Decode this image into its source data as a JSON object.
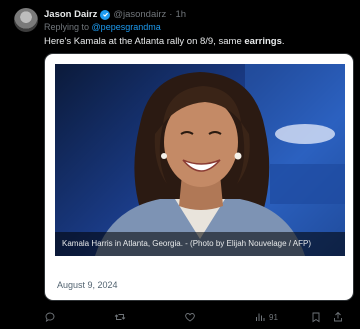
{
  "tweet": {
    "author_name": "Jason Dairz",
    "author_handle": "@jasondairz",
    "separator": "·",
    "time": "1h",
    "reply_prefix": "Replying to",
    "reply_mention": "@pepesgrandma",
    "text_start": "Here's Kamala at the Atlanta rally on 8/9, same ",
    "text_bold": "earrings",
    "text_end": ".",
    "media": {
      "caption": "Kamala Harris in Atlanta, Georgia. - (Photo by Elijah Nouvelage / AFP)",
      "date": "August 9, 2024"
    },
    "actions": {
      "views_count": "91"
    }
  },
  "icons": [
    "verified-badge-icon",
    "reply-icon",
    "retweet-icon",
    "like-icon",
    "views-icon",
    "bookmark-icon",
    "share-icon"
  ],
  "colors": {
    "accent": "#1d9bf0",
    "background": "#000000",
    "muted": "#71767b"
  }
}
